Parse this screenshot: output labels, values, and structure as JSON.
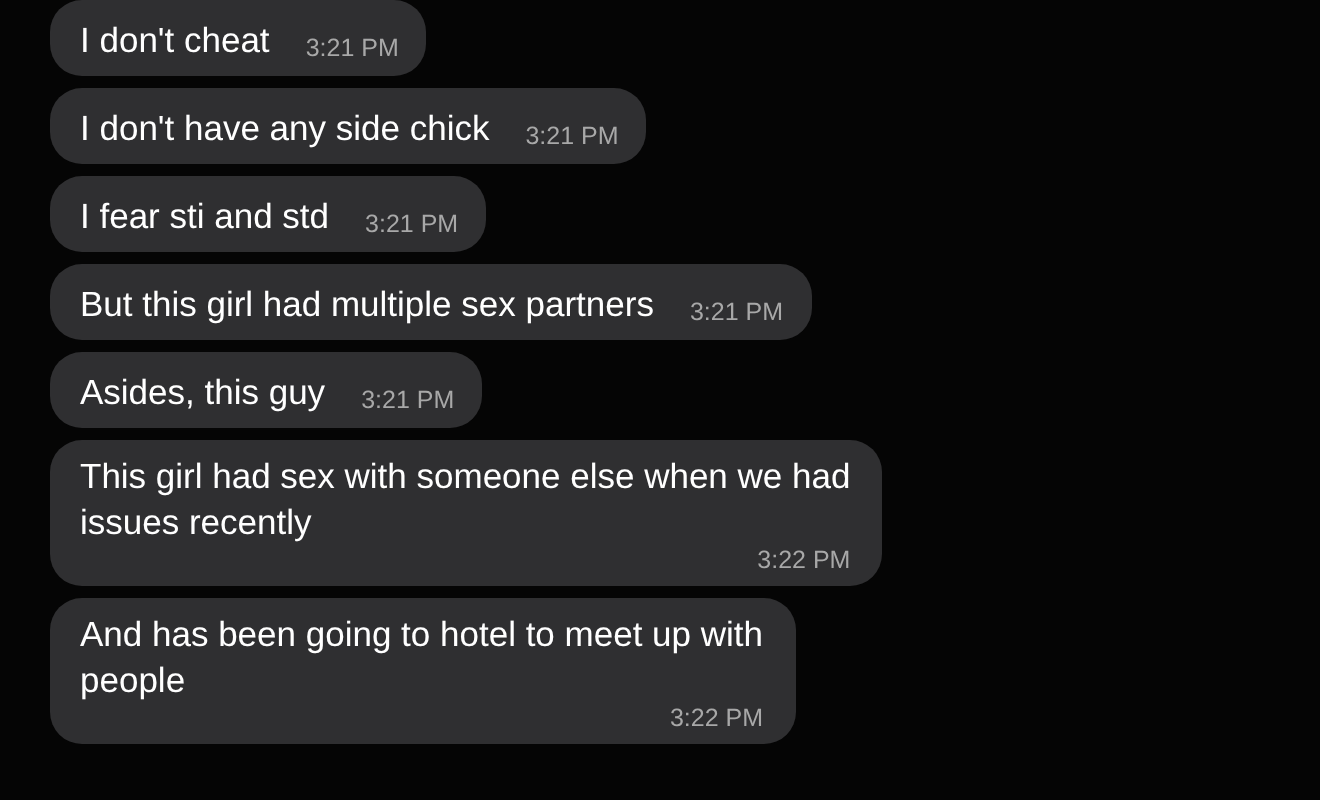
{
  "messages": [
    {
      "kind": "inline",
      "lines": [
        "I don't cheat"
      ],
      "time": "3:21 PM"
    },
    {
      "kind": "inline",
      "lines": [
        "I don't have any side chick"
      ],
      "time": "3:21 PM"
    },
    {
      "kind": "inline",
      "lines": [
        "I fear sti and std"
      ],
      "time": "3:21 PM"
    },
    {
      "kind": "inline",
      "lines": [
        "But this girl had multiple sex partners"
      ],
      "time": "3:21 PM"
    },
    {
      "kind": "inline",
      "lines": [
        "Asides, this guy"
      ],
      "time": "3:21 PM"
    },
    {
      "kind": "stacked",
      "lines": [
        "This girl had sex with someone else when we had",
        "issues recently"
      ],
      "time": "3:22 PM"
    },
    {
      "kind": "stacked",
      "lines": [
        "And has been going to hotel to meet up with",
        "people"
      ],
      "time": "3:22 PM"
    }
  ]
}
